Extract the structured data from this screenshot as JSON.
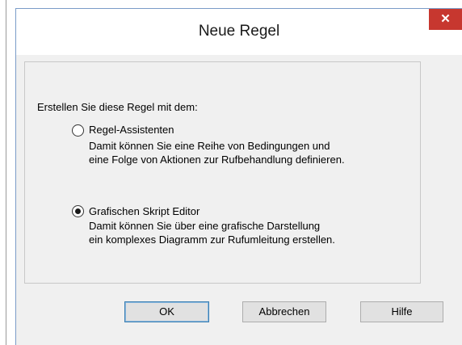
{
  "dialog": {
    "title": "Neue Regel",
    "close_glyph": "✕",
    "prompt": "Erstellen Sie diese Regel mit dem:",
    "options": [
      {
        "label": "Regel-Assistenten",
        "selected": false,
        "desc1": "Damit können Sie eine Reihe von Bedingungen und",
        "desc2": "eine Folge von Aktionen zur Rufbehandlung definieren."
      },
      {
        "label": "Grafischen Skript Editor",
        "selected": true,
        "desc1": "Damit können Sie über eine grafische Darstellung",
        "desc2": "ein komplexes Diagramm zur Rufumleitung erstellen."
      }
    ],
    "buttons": {
      "ok": "OK",
      "cancel": "Abbrechen",
      "help": "Hilfe"
    },
    "colors": {
      "close_bg": "#c7372f",
      "default_border": "#3c7fb1"
    }
  }
}
